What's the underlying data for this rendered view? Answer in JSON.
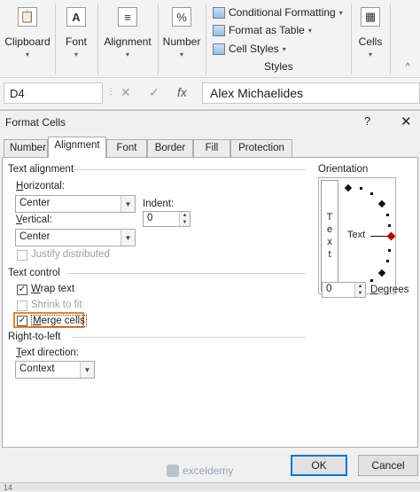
{
  "ribbon": {
    "groups": [
      {
        "label": "Clipboard",
        "icon": "clipboard-icon"
      },
      {
        "label": "Font",
        "icon": "font-icon"
      },
      {
        "label": "Alignment",
        "icon": "alignment-icon"
      },
      {
        "label": "Number",
        "icon": "number-icon"
      }
    ],
    "styles": {
      "items": [
        "Conditional Formatting",
        "Format as Table",
        "Cell Styles"
      ],
      "label": "Styles"
    },
    "cells": {
      "label": "Cells"
    }
  },
  "formula_bar": {
    "name_box": "D4",
    "cancel": "✕",
    "enter": "✓",
    "fx": "fx",
    "content": "Alex Michaelides"
  },
  "dialog": {
    "title": "Format Cells",
    "help": "?",
    "close": "✕",
    "tabs": [
      "Number",
      "Alignment",
      "Font",
      "Border",
      "Fill",
      "Protection"
    ],
    "active_tab": "Alignment",
    "text_alignment": {
      "section": "Text alignment",
      "horizontal_label": "Horizontal:",
      "horizontal_value": "Center",
      "indent_label": "Indent:",
      "indent_value": "0",
      "vertical_label": "Vertical:",
      "vertical_value": "Center",
      "justify_distributed": "Justify distributed"
    },
    "text_control": {
      "section": "Text control",
      "wrap_text": "Wrap text",
      "wrap_checked": true,
      "shrink_to_fit": "Shrink to fit",
      "merge_cells": "Merge cells",
      "merge_checked": true,
      "highlight_color": "#f07f2a"
    },
    "right_to_left": {
      "section": "Right-to-left",
      "text_direction_label": "Text direction:",
      "text_direction_value": "Context"
    },
    "orientation": {
      "section": "Orientation",
      "vertical_text": [
        "T",
        "e",
        "x",
        "t"
      ],
      "dial_text": "Text",
      "degrees_value": "0",
      "degrees_label": "Degrees",
      "pointer_color": "#c00000"
    },
    "buttons": {
      "ok": "OK",
      "cancel": "Cancel"
    }
  },
  "watermark": "exceldemy",
  "status_row": "14"
}
